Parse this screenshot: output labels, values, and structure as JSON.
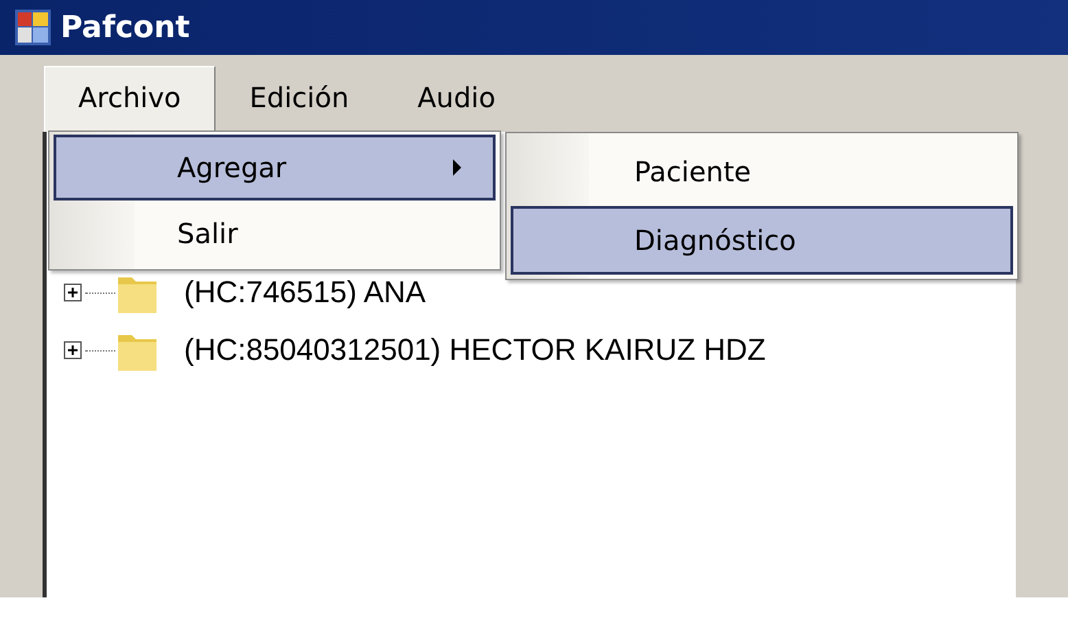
{
  "window": {
    "title": "Pafcont"
  },
  "menu_bar": [
    {
      "label": "Archivo",
      "selected": true
    },
    {
      "label": "Edición",
      "selected": false
    },
    {
      "label": "Audio",
      "selected": false
    }
  ],
  "menu": [
    {
      "label": "Agregar",
      "selected": true,
      "has_submenu": true
    },
    {
      "label": "Salir",
      "selected": false,
      "has_submenu": false
    }
  ],
  "submenu": [
    {
      "label": "Paciente",
      "selected": false
    },
    {
      "label": "Diagnóstico",
      "selected": true
    }
  ],
  "tree": [
    {
      "label": "(HC:746515) ANA",
      "expanded": false
    },
    {
      "label": "(HC:85040312501) HECTOR KAIRUZ HDZ",
      "expanded": false
    }
  ]
}
